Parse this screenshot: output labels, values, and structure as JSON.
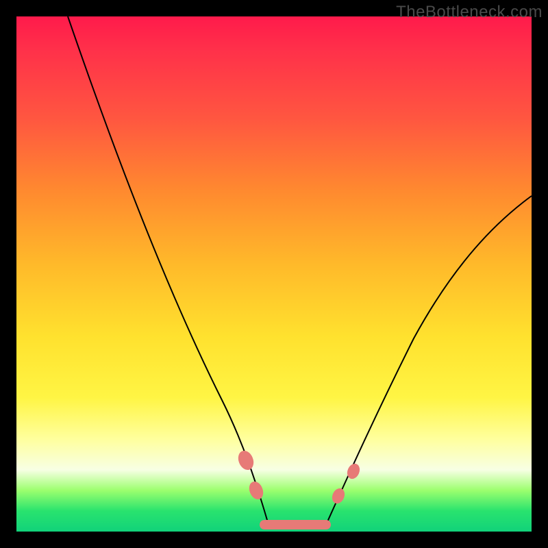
{
  "watermark": "TheBottleneck.com",
  "chart_data": {
    "type": "line",
    "title": "",
    "xlabel": "",
    "ylabel": "",
    "xlim": [
      0,
      100
    ],
    "ylim": [
      0,
      100
    ],
    "series": [
      {
        "name": "left-branch",
        "x": [
          10,
          15,
          20,
          25,
          30,
          35,
          40,
          44,
          47,
          49
        ],
        "y": [
          100,
          88,
          76,
          64,
          52,
          40,
          27,
          15,
          6,
          0
        ]
      },
      {
        "name": "right-branch",
        "x": [
          60,
          63,
          67,
          72,
          78,
          85,
          92,
          100
        ],
        "y": [
          0,
          5,
          12,
          22,
          34,
          46,
          56,
          65
        ]
      },
      {
        "name": "valley-floor",
        "x": [
          49,
          60
        ],
        "y": [
          0,
          0
        ]
      }
    ],
    "markers": [
      {
        "name": "left-dot-upper",
        "x": 44,
        "y": 13
      },
      {
        "name": "left-dot-lower",
        "x": 46,
        "y": 7
      },
      {
        "name": "right-dot-lower",
        "x": 62,
        "y": 6
      },
      {
        "name": "right-dot-upper",
        "x": 65,
        "y": 11
      }
    ],
    "marker_color": "#e77a77",
    "curve_color": "#000000"
  }
}
